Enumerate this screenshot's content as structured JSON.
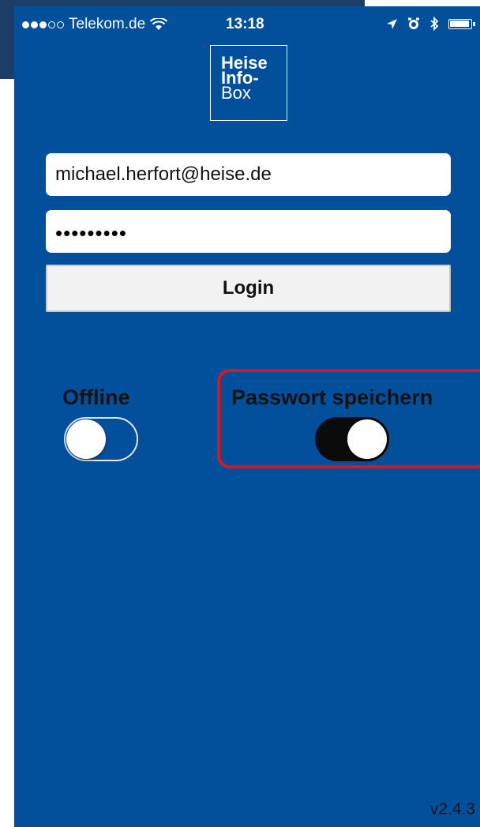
{
  "status_bar": {
    "carrier": "Telekom.de",
    "time": "13:18"
  },
  "logo": {
    "line1": "Heise",
    "line2": "Info-",
    "line3": "Box"
  },
  "login_form": {
    "email_value": "michael.herfort@heise.de",
    "password_mask": "•••••••••",
    "login_label": "Login"
  },
  "settings": {
    "offline_label": "Offline",
    "offline_on": false,
    "save_password_label": "Passwort speichern",
    "save_password_on": true
  },
  "footer": {
    "version": "v2.4.3"
  },
  "colors": {
    "background": "#02509c",
    "highlight": "#e0141e"
  }
}
